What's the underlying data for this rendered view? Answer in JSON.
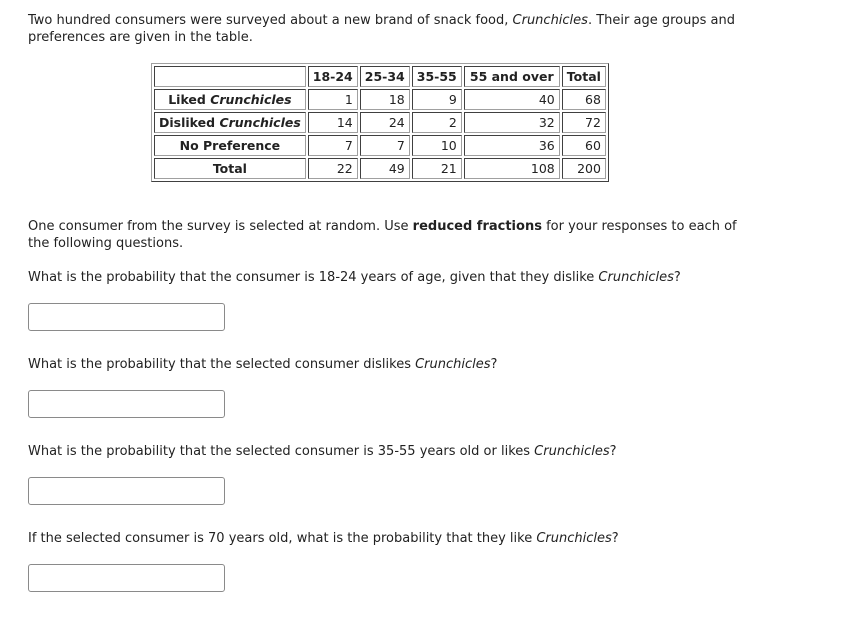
{
  "intro": {
    "text_before": "Two hundred consumers were surveyed about a new brand of snack food, ",
    "brand": "Crunchicles",
    "text_after": ". Their age groups and preferences are given in the table."
  },
  "table": {
    "corner": "",
    "columns": [
      "18-24",
      "25-34",
      "35-55",
      "55 and over",
      "Total"
    ],
    "rows": [
      {
        "label_prefix": "Liked ",
        "label_italic": "Crunchicles",
        "values": [
          "1",
          "18",
          "9",
          "40",
          "68"
        ]
      },
      {
        "label_prefix": "Disliked ",
        "label_italic": "Crunchicles",
        "values": [
          "14",
          "24",
          "2",
          "32",
          "72"
        ]
      },
      {
        "label_prefix": "No Preference",
        "label_italic": "",
        "values": [
          "7",
          "7",
          "10",
          "36",
          "60"
        ]
      },
      {
        "label_prefix": "Total",
        "label_italic": "",
        "values": [
          "22",
          "49",
          "21",
          "108",
          "200"
        ]
      }
    ]
  },
  "instructions": {
    "text_before": "One consumer from the survey is selected at random. Use ",
    "bold": "reduced fractions",
    "text_after": " for your responses to each of the following questions."
  },
  "questions": [
    {
      "text_before": "What is the probability that the consumer is 18-24 years of age, given that they dislike ",
      "italic": "Crunchicles",
      "text_after": "?",
      "answer_value": ""
    },
    {
      "text_before": "What is the probability that the selected consumer dislikes ",
      "italic": "Crunchicles",
      "text_after": "?",
      "answer_value": ""
    },
    {
      "text_before": "What is the probability that the selected consumer is 35-55 years old or likes ",
      "italic": "Crunchicles",
      "text_after": "?",
      "answer_value": ""
    },
    {
      "text_before": "If the selected consumer is 70 years old, what is the probability that they like ",
      "italic": "Crunchicles",
      "text_after": "?",
      "answer_value": ""
    }
  ]
}
